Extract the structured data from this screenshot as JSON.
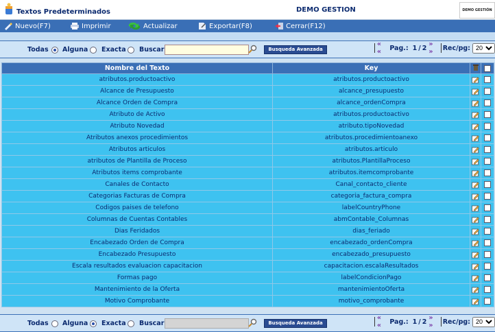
{
  "window": {
    "title": "Textos Predeterminados",
    "company": "DEMO GESTION",
    "logo_text": "DEMO GESTIÓN"
  },
  "toolbar": {
    "nuevo": "Nuevo(F7)",
    "imprimir": "Imprimir",
    "actualizar": "Actualizar",
    "exportar": "Exportar(F8)",
    "cerrar": "Cerrar(F12)"
  },
  "search_top": {
    "todas": "Todas",
    "alguna": "Alguna",
    "exacta": "Exacta",
    "buscar": "Buscar",
    "selected": "todas",
    "value": "",
    "advanced": "Busqueda Avanzada"
  },
  "search_bottom": {
    "todas": "Todas",
    "alguna": "Alguna",
    "exacta": "Exacta",
    "buscar": "Buscar",
    "selected": "alguna",
    "value": "",
    "advanced": "Busqueda Avanzada"
  },
  "pager": {
    "first_prev": "« «",
    "pag_label": "Pag.:",
    "current": "1",
    "slash": "/",
    "total": "2",
    "next_last": "» »",
    "recpg_label": "Rec/pg:",
    "recpg_value": "20"
  },
  "table": {
    "headers": {
      "nombre": "Nombre del Texto",
      "key": "Key"
    },
    "rows": [
      {
        "nombre": "atributos.productoactivo",
        "key": "atributos.productoactivo"
      },
      {
        "nombre": "Alcance de Presupuesto",
        "key": "alcance_presupuesto"
      },
      {
        "nombre": "Alcance Orden de Compra",
        "key": "alcance_ordenCompra"
      },
      {
        "nombre": "Atributo de Activo",
        "key": "atributos.productoactivo"
      },
      {
        "nombre": "Atributo Novedad",
        "key": "atributo.tipoNovedad"
      },
      {
        "nombre": "Atributos anexos procedimientos",
        "key": "atributos.procedimientoanexo"
      },
      {
        "nombre": "Atributos articulos",
        "key": "atributos.articulo"
      },
      {
        "nombre": "atributos de Plantilla de Proceso",
        "key": "atributos.PlantillaProceso"
      },
      {
        "nombre": "Atributos items comprobante",
        "key": "atributos.itemcomprobante"
      },
      {
        "nombre": "Canales de Contacto",
        "key": "Canal_contacto_cliente"
      },
      {
        "nombre": "Categorias Facturas de Compra",
        "key": "categoria_factura_compra"
      },
      {
        "nombre": "Codigos paises de telefono",
        "key": "labelCountryPhone"
      },
      {
        "nombre": "Columnas de Cuentas Contables",
        "key": "abmContable_Columnas"
      },
      {
        "nombre": "Dias Feridados",
        "key": "dias_feriado"
      },
      {
        "nombre": "Encabezado Orden de Compra",
        "key": "encabezado_ordenCompra"
      },
      {
        "nombre": "Encabezado Presupuesto",
        "key": "encabezado_presupuesto"
      },
      {
        "nombre": "Escala resultados evaluacion capacitacion",
        "key": "capacitacion.escalaResultados"
      },
      {
        "nombre": "Formas pago",
        "key": "labelCondicionPago"
      },
      {
        "nombre": "Mantenimiento de la Oferta",
        "key": "mantenimientoOferta"
      },
      {
        "nombre": "Motivo Comprobante",
        "key": "motivo_comprobante"
      }
    ]
  },
  "colors": {
    "toolbar": "#3a6fb6",
    "row": "#3ec2f0",
    "header": "#3a6fb6",
    "background": "#cfe2f2"
  }
}
